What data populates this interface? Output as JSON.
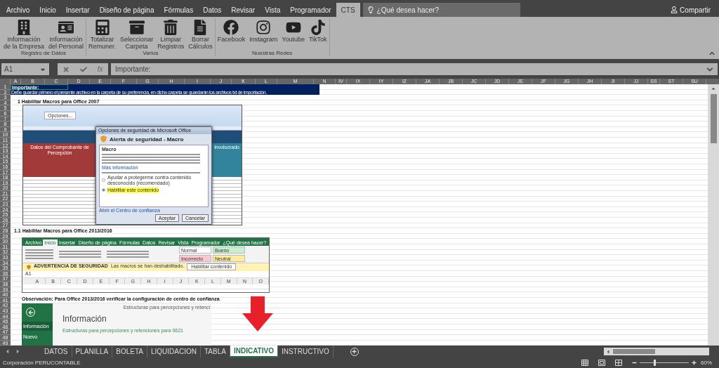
{
  "menu_tabs": [
    {
      "label": "Archivo",
      "selected": false
    },
    {
      "label": "Inicio",
      "selected": false
    },
    {
      "label": "Insertar",
      "selected": false
    },
    {
      "label": "Diseño de página",
      "selected": false
    },
    {
      "label": "Fórmulas",
      "selected": false
    },
    {
      "label": "Datos",
      "selected": false
    },
    {
      "label": "Revisar",
      "selected": false
    },
    {
      "label": "Vista",
      "selected": false
    },
    {
      "label": "Programador",
      "selected": false
    },
    {
      "label": "CTS",
      "selected": true
    }
  ],
  "search": {
    "placeholder": "¿Qué desea hacer?"
  },
  "share": "Compartir",
  "ribbon_groups": [
    {
      "title": "Registro de Datos",
      "buttons": [
        [
          "Información",
          "de la Empresa"
        ],
        [
          "Información",
          "del Personal"
        ]
      ]
    },
    {
      "title": "Varios",
      "buttons": [
        [
          "Totalizar",
          "Remuner."
        ],
        [
          "Seleccionar",
          "Carpeta"
        ],
        [
          "Limpiar",
          "Registros"
        ],
        [
          "Borrar",
          "Cálculos"
        ]
      ]
    },
    {
      "title": "Nuestras Redes",
      "buttons": [
        [
          "Facebook"
        ],
        [
          "Instagram"
        ],
        [
          "Youtube"
        ],
        [
          "TikTok"
        ]
      ]
    }
  ],
  "formula_bar": {
    "name_box": "A1",
    "fx": "fx",
    "value": "Importante:"
  },
  "columns": [
    "A",
    "B",
    "C",
    "D",
    "E",
    "F",
    "G",
    "H",
    "I",
    "J",
    "K",
    "L",
    "M",
    "N",
    "IV",
    "IX",
    "IY",
    "IZ",
    "JA",
    "JB",
    "JC",
    "JD",
    "JE",
    "JF",
    "JG",
    "JH",
    "JI",
    "JJ",
    "SS",
    "ST",
    "SU"
  ],
  "rows": [
    "1",
    "2",
    "3",
    "4",
    "5",
    "6",
    "7",
    "8",
    "9",
    "10",
    "11",
    "12",
    "13",
    "14",
    "15",
    "16",
    "17",
    "18",
    "19",
    "20",
    "21",
    "22",
    "23",
    "24",
    "25",
    "26",
    "27",
    "28",
    "29",
    "30",
    "31",
    "32",
    "33",
    "34",
    "35",
    "36",
    "37",
    "38",
    "39",
    "40",
    "41",
    "42",
    "43",
    "44",
    "45",
    "46",
    "47",
    "48",
    "49"
  ],
  "banner": {
    "title": "Importante:",
    "note": "Debe guardar primero el presente archivo en la carpeta de su preferencia, en dicha carpeta se guardarán los archivos txt de importación."
  },
  "section_1": {
    "heading": "1 Habilitar Macros  para Office 2007",
    "screenshot": {
      "band": "Datos del Comprobante de Percepción",
      "band_2": "involucrado",
      "options_button": "Opciones...",
      "dialog_caption": "Opciones de seguridad de Microsoft Office",
      "dialog_title": "Alerta de seguridad - Macro",
      "section": "Macro",
      "link": "Más información",
      "option_1": {
        "label": "Ayudar a protegerme contra contenido desconocido (recomendado)",
        "selected": false
      },
      "option_2": {
        "label": "Habilitar este contenido",
        "selected": true
      },
      "footer_link": "Abrir el Centro de confianza",
      "buttons": [
        "Aceptar",
        "Cancelar"
      ]
    }
  },
  "section_2": {
    "heading": "1.1 Habilitar Macros  para Office 2013/2016",
    "screenshot": {
      "tabs": [
        {
          "label": "Archivo",
          "selected": false
        },
        {
          "label": "Inicio",
          "selected": true
        },
        {
          "label": "Insertar",
          "selected": false
        },
        {
          "label": "Diseño de página",
          "selected": false
        },
        {
          "label": "Fórmulas",
          "selected": false
        },
        {
          "label": "Datos",
          "selected": false
        },
        {
          "label": "Revisar",
          "selected": false
        },
        {
          "label": "Vista",
          "selected": false
        },
        {
          "label": "Programador",
          "selected": false
        },
        {
          "label": "¿Qué desea hacer?",
          "selected": false
        }
      ],
      "styles": [
        {
          "label": "Normal",
          "color": "#ffffff"
        },
        {
          "label": "Bueno",
          "color": "#c6efce"
        },
        {
          "label": "Incorrecto",
          "color": "#ffc7ce"
        },
        {
          "label": "Neutral",
          "color": "#ffeb9c"
        }
      ],
      "warning_title": "ADVERTENCIA DE SEGURIDAD",
      "warning_text": "Las macros se han deshabilitado.",
      "warning_button": "Habilitar contenido",
      "name_box": "A1",
      "columns": [
        "A",
        "B",
        "C",
        "D",
        "E",
        "F",
        "G",
        "H",
        "I",
        "J",
        "K",
        "L",
        "M",
        "N",
        "O"
      ]
    }
  },
  "section_3": {
    "heading": "Observación: Para Office 2013/2016 verificar la configuración de  centro de confianza",
    "screenshot": {
      "caption": "Estructuras para percepciones y retenci",
      "sidebar": [
        {
          "label": "Información",
          "selected": true
        },
        {
          "label": "Nuevo",
          "selected": false
        }
      ],
      "title": "Información",
      "subtitle": "Estructuras para percepciones y retenciones para 0621"
    }
  },
  "sheet_tabs": [
    {
      "label": "DATOS",
      "selected": false
    },
    {
      "label": "PLANILLA",
      "selected": false
    },
    {
      "label": "BOLETA",
      "selected": false
    },
    {
      "label": "LIQUIDACION",
      "selected": false
    },
    {
      "label": "TABLA",
      "selected": false
    },
    {
      "label": "INDICATIVO",
      "selected": true
    },
    {
      "label": "INSTRUCTIVO",
      "selected": false
    }
  ],
  "status_bar": {
    "text": "Corporación PERUCONTABLE",
    "zoom": {
      "level": 0.3,
      "reading": "60%"
    }
  }
}
